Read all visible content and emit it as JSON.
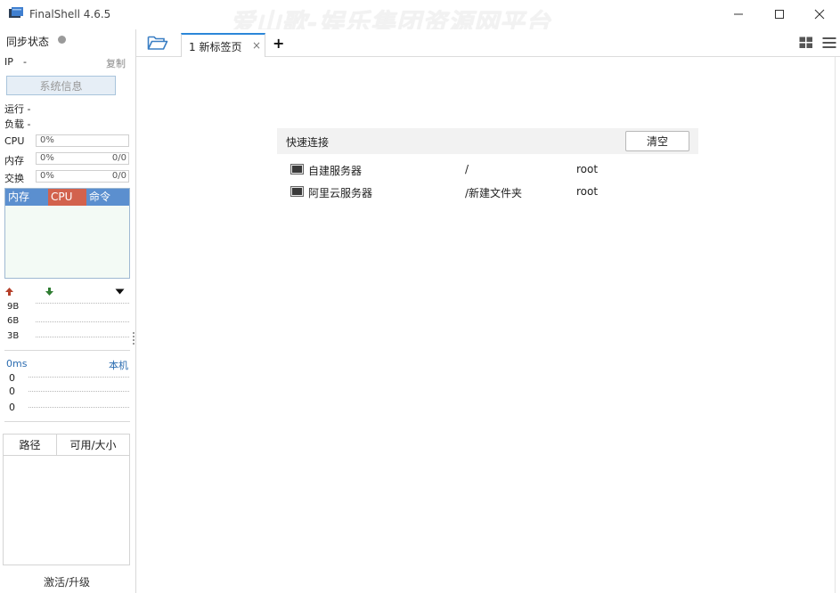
{
  "app": {
    "title": "FinalShell 4.6.5",
    "watermark": "爱山歌-娱乐集团资源网平台"
  },
  "window_controls": {
    "minimize": "—",
    "maximize": "☐",
    "close": "✕"
  },
  "sidebar": {
    "sync_label": "同步状态",
    "ip_label": "IP",
    "ip_value": "-",
    "copy_label": "复制",
    "sysinfo_button": "系统信息",
    "run_label": "运行 -",
    "load_label": "负载 -",
    "cpu": {
      "label": "CPU",
      "percent": "0%"
    },
    "mem": {
      "label": "内存",
      "percent": "0%",
      "amount": "0/0"
    },
    "swap": {
      "label": "交换",
      "percent": "0%",
      "amount": "0/0"
    },
    "process_headers": {
      "mem": "内存",
      "cpu": "CPU",
      "cmd": "命令"
    },
    "net_labels": [
      "9B",
      "6B",
      "3B"
    ],
    "ping": {
      "latency": "0ms",
      "host": "本机",
      "values": [
        "0",
        "0",
        "0"
      ]
    },
    "disk_headers": {
      "path": "路径",
      "available": "可用/大小"
    },
    "activate": "激活/升级"
  },
  "tabs": [
    {
      "label": "1 新标签页",
      "close": "×"
    }
  ],
  "add_tab": "+",
  "quick_connect": {
    "title": "快速连接",
    "clear_button": "清空",
    "items": [
      {
        "name": "自建服务器",
        "path": "/",
        "user": "root"
      },
      {
        "name": "阿里云服务器",
        "path": "/新建文件夹",
        "user": "root"
      }
    ]
  },
  "colors": {
    "accent": "#2b87d8",
    "proc_mem": "#5b8fcf",
    "proc_cpu": "#d2624d",
    "upload_arrow": "#b5402a",
    "download_arrow": "#2f7d32",
    "ping_text": "#2b6cb0"
  }
}
